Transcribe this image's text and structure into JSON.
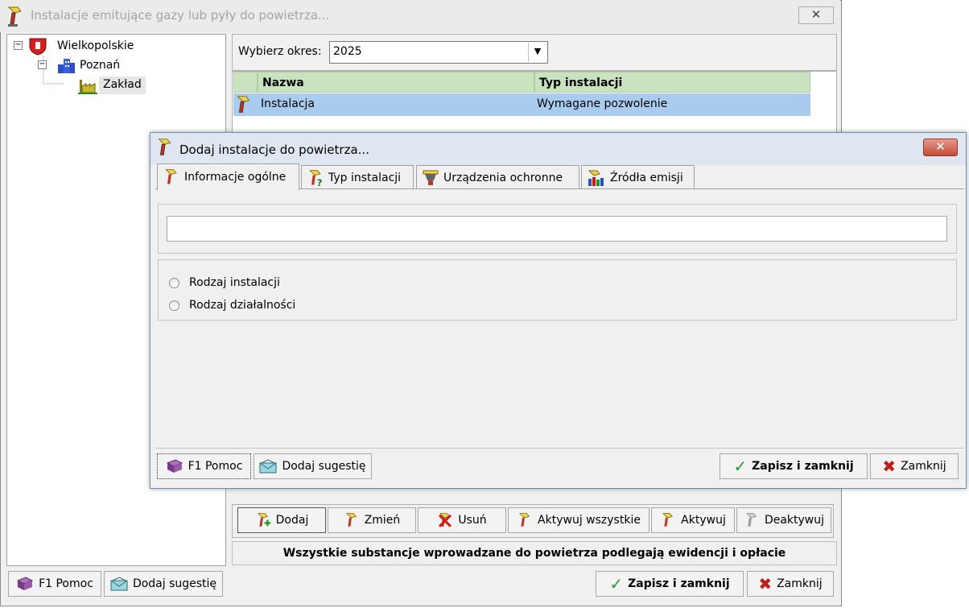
{
  "main_window": {
    "title": "Instalacje emitujące gazy lub pyły do powietrza...",
    "close_symbol": "✕",
    "tree": {
      "root": {
        "label": "Wielkopolskie",
        "icon": "shield-icon"
      },
      "child": {
        "label": "Poznań",
        "icon": "buildings-icon"
      },
      "leaf": {
        "label": "Zakład",
        "icon": "factory-icon"
      }
    },
    "period": {
      "label": "Wybierz okres:",
      "value": "2025"
    },
    "grid": {
      "columns": [
        "Nazwa",
        "Typ instalacji"
      ],
      "rows": [
        {
          "name": "Instalacja",
          "type": "Wymagane pozwolenie"
        }
      ]
    },
    "toolbar": {
      "add": "Dodaj",
      "edit": "Zmień",
      "delete": "Usuń",
      "activate_all": "Aktywuj wszystkie",
      "activate": "Aktywuj",
      "deactivate": "Deaktywuj"
    },
    "info": "Wszystkie substancje wprowadzane do powietrza podlegają ewidencji i opłacie",
    "footer": {
      "help": "F1 Pomoc",
      "suggest": "Dodaj sugestię",
      "save_close": "Zapisz i zamknij",
      "close": "Zamknij"
    }
  },
  "dialog": {
    "title": "Dodaj instalacje do powietrza...",
    "close_symbol": "✕",
    "tabs": [
      {
        "label": "Informacje ogólne",
        "icon": "installation-icon"
      },
      {
        "label": "Typ instalacji",
        "icon": "installation-question-icon"
      },
      {
        "label": "Urządzenia ochronne",
        "icon": "filter-icon"
      },
      {
        "label": "Źródła emisji",
        "icon": "emission-sources-icon"
      }
    ],
    "name_value": "",
    "radios": [
      {
        "label": "Rodzaj instalacji",
        "checked": false
      },
      {
        "label": "Rodzaj działalności",
        "checked": false
      }
    ],
    "footer": {
      "help": "F1 Pomoc",
      "suggest": "Dodaj sugestię",
      "save_close": "Zapisz i zamknij",
      "close": "Zamknij"
    }
  },
  "colors": {
    "grid_header": "#c9e3bf",
    "selected_row": "#a9cbee",
    "dialog_close": "#c34a36"
  }
}
